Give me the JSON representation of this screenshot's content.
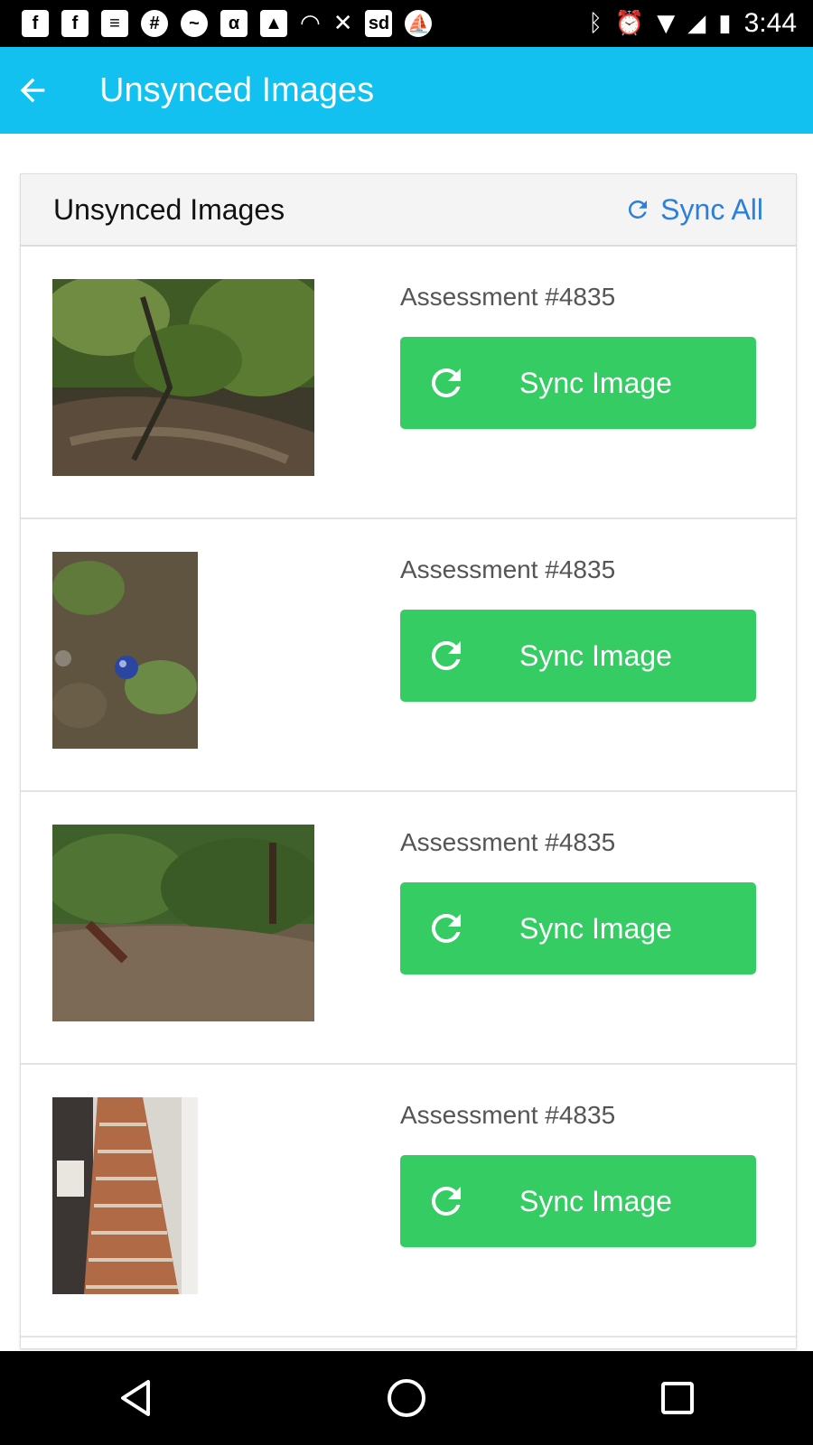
{
  "status_bar": {
    "time": "3:44",
    "left_icons": [
      "facebook-icon",
      "facebook-icon",
      "document-icon",
      "slack-icon",
      "messenger-icon",
      "alpha-icon",
      "image-icon",
      "wifi-tmobile-icon",
      "missed-call-icon",
      "sd-icon",
      "sailboat-icon"
    ],
    "right_icons": [
      "bluetooth-icon",
      "alarm-icon",
      "wifi-icon",
      "signal-icon",
      "battery-icon"
    ]
  },
  "app_bar": {
    "title": "Unsynced Images",
    "back_icon": "arrow-left-icon",
    "background": "#12c1f0"
  },
  "card": {
    "title": "Unsynced Images",
    "sync_all_label": "Sync All",
    "sync_all_color": "#2d7fd9"
  },
  "items": [
    {
      "assessment": "Assessment #4835",
      "button_label": "Sync Image",
      "image": "forest-path-photo"
    },
    {
      "assessment": "Assessment #4835",
      "button_label": "Sync Image",
      "image": "ground-ball-photo"
    },
    {
      "assessment": "Assessment #4835",
      "button_label": "Sync Image",
      "image": "forest-slope-photo"
    },
    {
      "assessment": "Assessment #4835",
      "button_label": "Sync Image",
      "image": "staircase-photo"
    }
  ],
  "colors": {
    "sync_button": "#35cc63",
    "accent": "#12c1f0"
  },
  "nav_bar": {
    "icons": [
      "back-triangle-icon",
      "home-circle-icon",
      "recents-square-icon"
    ]
  }
}
